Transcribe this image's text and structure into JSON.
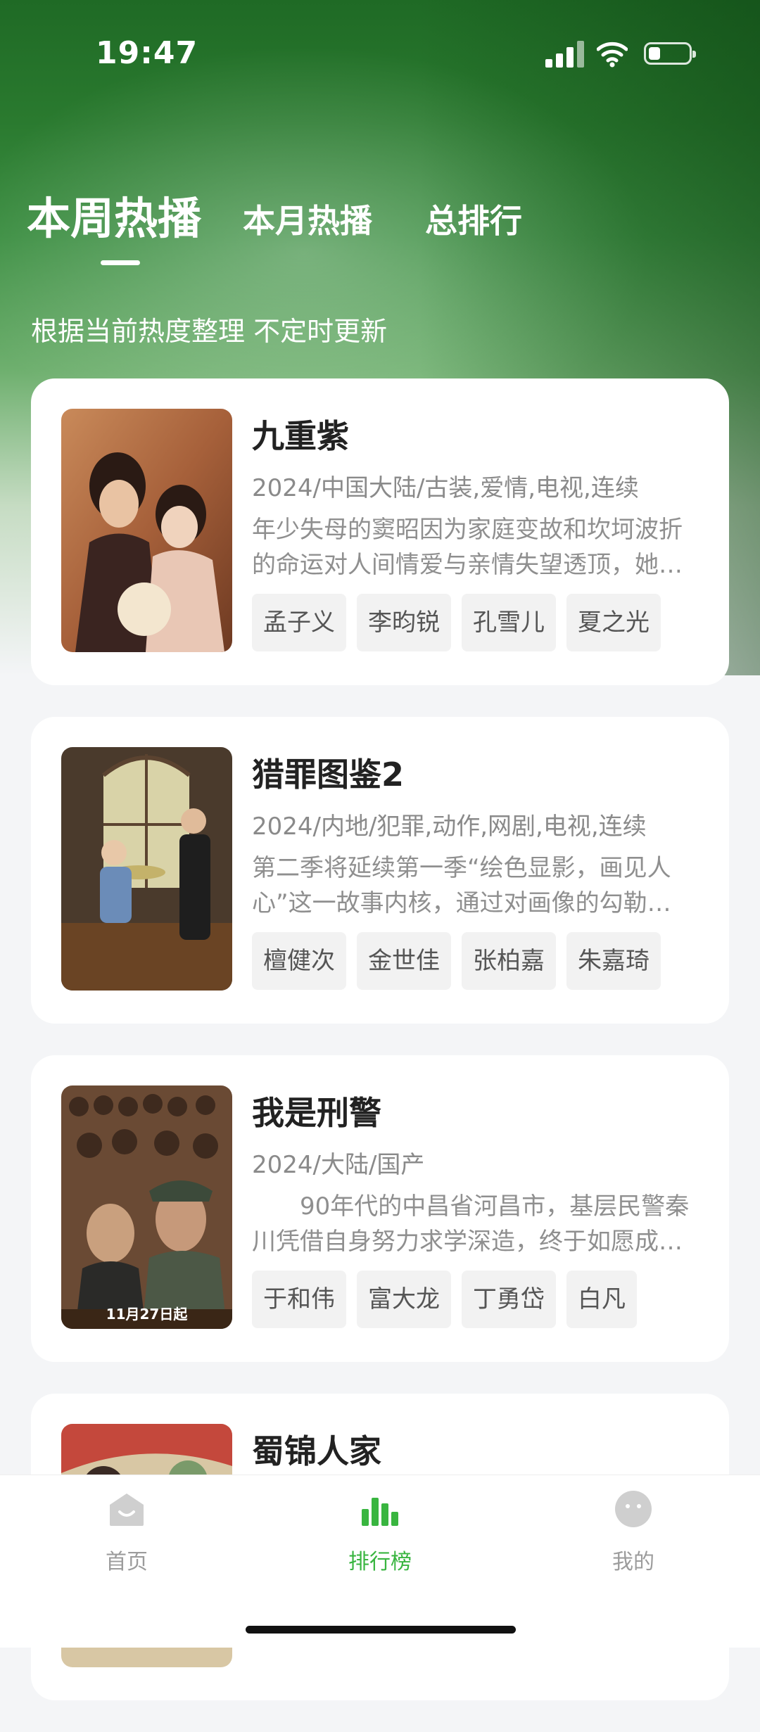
{
  "status_bar": {
    "time": "19:47"
  },
  "tabs": [
    {
      "label": "本周热播",
      "active": true
    },
    {
      "label": "本月热播",
      "active": false
    },
    {
      "label": "总排行",
      "active": false
    }
  ],
  "subtitle": "根据当前热度整理 不定时更新",
  "items": [
    {
      "title": "九重紫",
      "meta": "2024/中国大陆/古装,爱情,电视,连续",
      "desc": "年少失母的窦昭因为家庭变故和坎坷波折的命运对人间情爱与亲情失望透顶，她…",
      "tags": [
        "孟子义",
        "李昀锐",
        "孔雪儿",
        "夏之光"
      ]
    },
    {
      "title": "猎罪图鉴2",
      "meta": "2024/内地/犯罪,动作,网剧,电视,连续",
      "desc": "第二季将延续第一季“绘色显影，画见人心”这一故事内核，通过对画像的勾勒…",
      "tags": [
        "檀健次",
        "金世佳",
        "张柏嘉",
        "朱嘉琦"
      ]
    },
    {
      "title": "我是刑警",
      "meta": "2024/大陆/国产",
      "desc": "　　90年代的中昌省河昌市，基层民警秦川凭借自身努力求学深造，终于如愿成…",
      "tags": [
        "于和伟",
        "富大龙",
        "丁勇岱",
        "白凡"
      ],
      "poster_text": "11月27日起"
    },
    {
      "title": "蜀锦人家",
      "meta": "",
      "desc": "",
      "tags": []
    }
  ],
  "bottom_nav": [
    {
      "label": "首页",
      "icon": "home-icon",
      "active": false
    },
    {
      "label": "排行榜",
      "icon": "ranking-icon",
      "active": true
    },
    {
      "label": "我的",
      "icon": "profile-icon",
      "active": false
    }
  ],
  "colors": {
    "accent": "#39b540",
    "header_green": "#2a7a2f"
  }
}
